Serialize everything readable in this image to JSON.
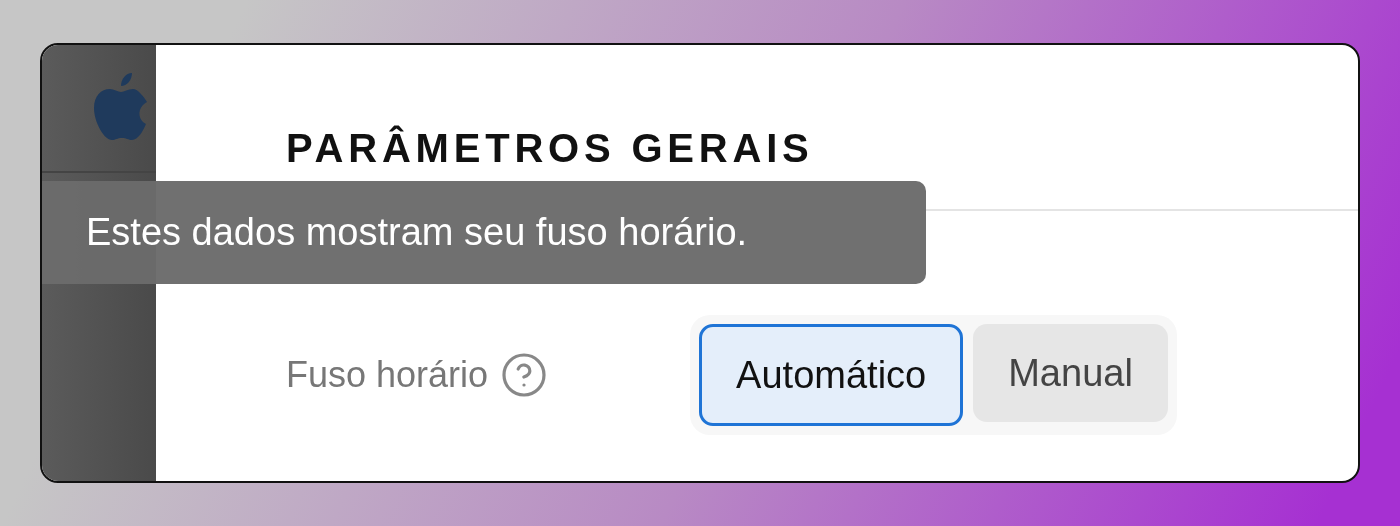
{
  "section_title": "PARÂMETROS GERAIS",
  "tooltip": {
    "text": "Estes dados mostram seu fuso horário."
  },
  "setting": {
    "label": "Fuso horário",
    "options": [
      {
        "label": "Automático",
        "selected": true
      },
      {
        "label": "Manual",
        "selected": false
      }
    ]
  }
}
